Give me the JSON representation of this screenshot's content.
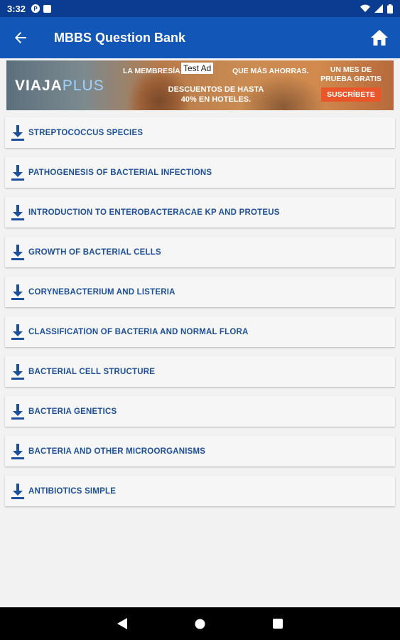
{
  "status_bar": {
    "time": "3:32"
  },
  "app_bar": {
    "title": "MBBS Question Bank"
  },
  "ad": {
    "tag": "Test Ad",
    "logo_main": "VIAJA",
    "logo_plus": "PLUS",
    "headline_left": "LA MEMBRESÍA",
    "headline_right": "QUE MÁS AHORRAS.",
    "offer_line1": "DESCUENTOS DE HASTA",
    "offer_line2": "40% EN HOTELES.",
    "right_line1": "UN MES DE",
    "right_line2": "PRUEBA GRATIS",
    "cta": "SUSCRÍBETE"
  },
  "topics": [
    {
      "label": "STREPTOCOCCUS SPECIES"
    },
    {
      "label": "PATHOGENESIS OF BACTERIAL INFECTIONS"
    },
    {
      "label": "INTRODUCTION TO ENTEROBACTERACAE KP AND PROTEUS"
    },
    {
      "label": "GROWTH OF BACTERIAL CELLS"
    },
    {
      "label": "CORYNEBACTERIUM AND LISTERIA"
    },
    {
      "label": "CLASSIFICATION OF BACTERIA AND NORMAL FLORA"
    },
    {
      "label": "BACTERIAL CELL STRUCTURE"
    },
    {
      "label": "BACTERIA GENETICS"
    },
    {
      "label": "BACTERIA AND OTHER MICROORGANISMS"
    },
    {
      "label": "ANTIBIOTICS SIMPLE"
    }
  ],
  "colors": {
    "app_bar": "#1257b8",
    "status_bar": "#0a3d91",
    "topic_text": "#1c4f9c",
    "cta": "#e8562a"
  }
}
